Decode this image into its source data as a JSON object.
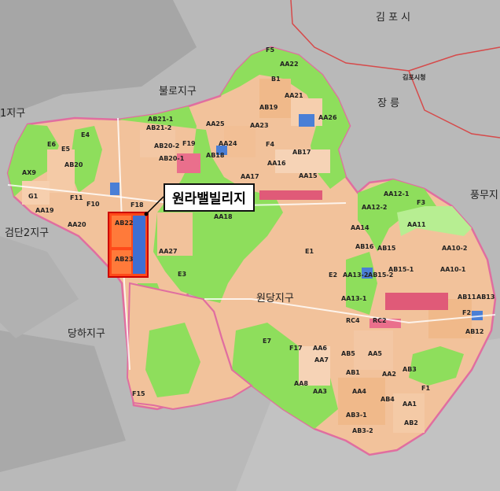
{
  "map": {
    "highlight_label": "원라밸빌리지",
    "districts": [
      "김 포 시",
      "불로지구",
      "검단2지구",
      "당하지구",
      "원당지구",
      "풍무지",
      "장 릉",
      "김포시청",
      "1지구"
    ],
    "lots": [
      "F5",
      "AA22",
      "B1",
      "AA21",
      "AA26",
      "AB19",
      "AA25",
      "AA23",
      "AB21-1",
      "AB21-2",
      "AB20-2",
      "AB20-1",
      "F19",
      "AA24",
      "AB18",
      "F4",
      "AB17",
      "E6",
      "E5",
      "E4",
      "AX9",
      "AB20",
      "AA16",
      "AA17",
      "AA15",
      "G1",
      "F11",
      "F10",
      "F18",
      "AA19",
      "AA18",
      "AA20",
      "AA12-1",
      "AA12-2",
      "F3",
      "AA14",
      "AA11",
      "AB16",
      "AB15",
      "AA10-2",
      "AA13-2",
      "AB15-2",
      "AB15-1",
      "AA10-1",
      "AB22",
      "AB23",
      "AA27",
      "E3",
      "E2",
      "E1",
      "AA13-1",
      "RC4",
      "RC2",
      "F2",
      "AB11",
      "AB13",
      "AB12",
      "E7",
      "F17",
      "AA6",
      "AB5",
      "AA5",
      "AB3",
      "AA2",
      "AA8",
      "AB4",
      "AB1",
      "AB3-1",
      "AB3-2",
      "AA1",
      "AB2",
      "F15",
      "F1",
      "AA3",
      "AA4",
      "AA7"
    ]
  },
  "colors": {
    "background": "#bdbdbd",
    "residential": "#f4c49a",
    "park": "#8ede5c",
    "commercial": "#ea6f8c",
    "school": "#4a7fd6",
    "border": "#e06ea0",
    "highlight": "#ff2a00"
  }
}
